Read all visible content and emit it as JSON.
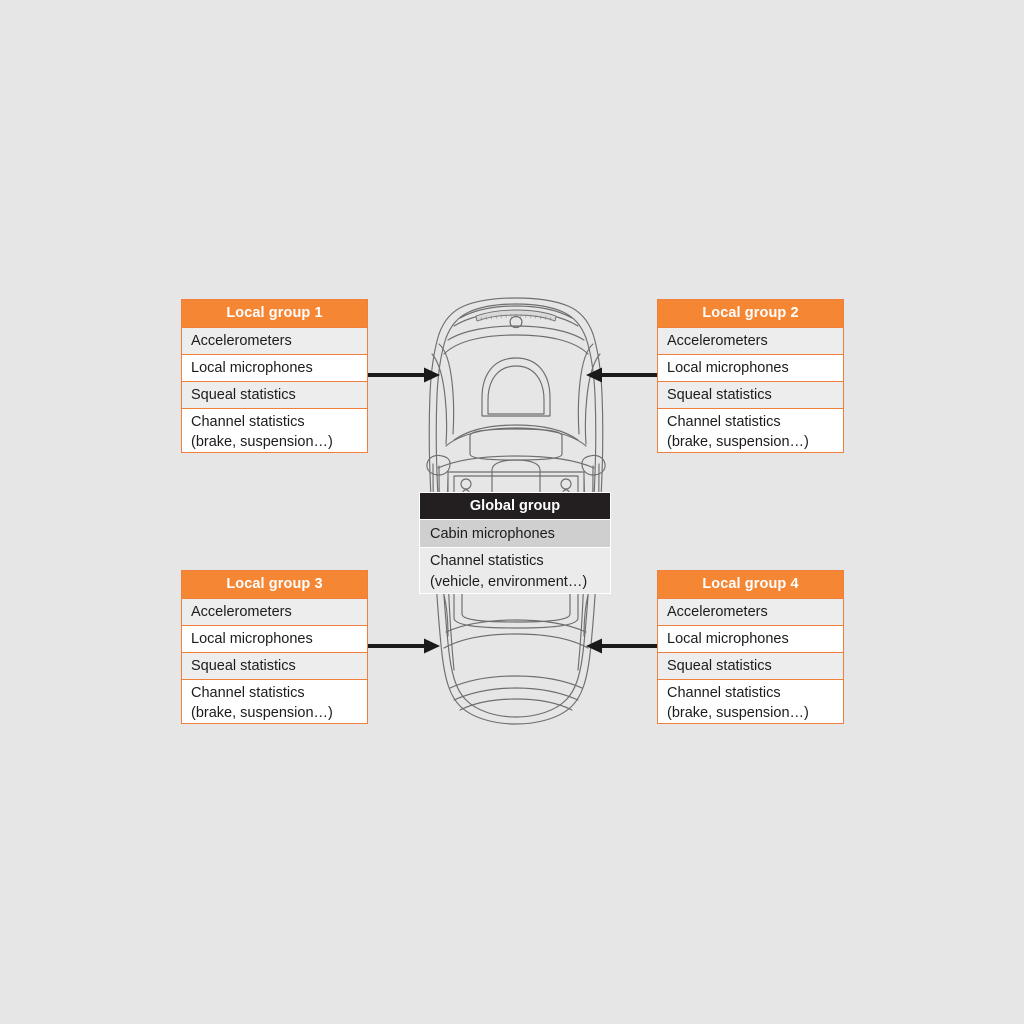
{
  "diagram": {
    "title": "Vehicle sensor grouping diagram",
    "background_color": "#e6e6e6",
    "accent_color": "#f58634",
    "accent_border_color": "#ef7f3c",
    "global_header_color": "#231f20",
    "row_shade_color": "#ededed",
    "global_row_shade_color": "#cfcfcf",
    "arrow_color": "#1a1a1a",
    "car_line_color": "#6e6e6e"
  },
  "local_groups": [
    {
      "id": "local-group-1",
      "header": "Local group 1",
      "position": "top-left",
      "rows": [
        {
          "label": "Accelerometers"
        },
        {
          "label": "Local microphones"
        },
        {
          "label": "Squeal statistics"
        },
        {
          "line1": "Channel statistics",
          "line2": "(brake, suspension…)"
        }
      ]
    },
    {
      "id": "local-group-2",
      "header": "Local group 2",
      "position": "top-right",
      "rows": [
        {
          "label": "Accelerometers"
        },
        {
          "label": "Local microphones"
        },
        {
          "label": "Squeal statistics"
        },
        {
          "line1": "Channel statistics",
          "line2": "(brake, suspension…)"
        }
      ]
    },
    {
      "id": "local-group-3",
      "header": "Local group 3",
      "position": "bottom-left",
      "rows": [
        {
          "label": "Accelerometers"
        },
        {
          "label": "Local microphones"
        },
        {
          "label": "Squeal statistics"
        },
        {
          "line1": "Channel statistics",
          "line2": "(brake, suspension…)"
        }
      ]
    },
    {
      "id": "local-group-4",
      "header": "Local group 4",
      "position": "bottom-right",
      "rows": [
        {
          "label": "Accelerometers"
        },
        {
          "label": "Local microphones"
        },
        {
          "label": "Squeal statistics"
        },
        {
          "line1": "Channel statistics",
          "line2": "(brake, suspension…)"
        }
      ]
    }
  ],
  "global_group": {
    "id": "global-group",
    "header": "Global group",
    "rows": [
      {
        "label": "Cabin microphones"
      },
      {
        "line1": "Channel statistics",
        "line2": "(vehicle, environment…)"
      }
    ]
  },
  "arrows": [
    {
      "id": "arrow-top-left",
      "direction": "right",
      "from": "local-group-1",
      "to": "vehicle"
    },
    {
      "id": "arrow-top-right",
      "direction": "left",
      "from": "local-group-2",
      "to": "vehicle"
    },
    {
      "id": "arrow-bottom-left",
      "direction": "right",
      "from": "local-group-3",
      "to": "vehicle"
    },
    {
      "id": "arrow-bottom-right",
      "direction": "left",
      "from": "local-group-4",
      "to": "vehicle"
    }
  ],
  "vehicle": {
    "id": "vehicle-illustration",
    "view": "top-down",
    "description": "Line drawing of a car seen from above"
  }
}
